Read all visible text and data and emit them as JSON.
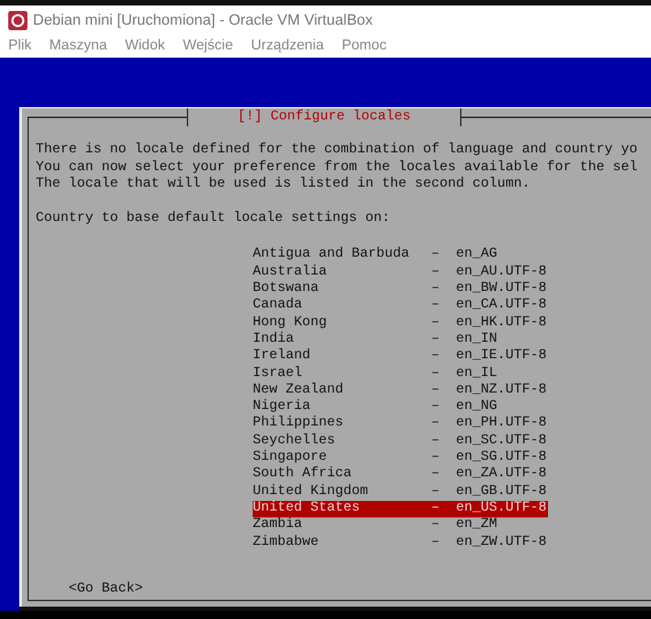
{
  "window": {
    "title": "Debian mini [Uruchomiona] - Oracle VM VirtualBox"
  },
  "menu": [
    "Plik",
    "Maszyna",
    "Widok",
    "Wejście",
    "Urządzenia",
    "Pomoc"
  ],
  "dialog": {
    "title": "[!] Configure locales",
    "message": [
      "There is no locale defined for the combination of language and country yo",
      "You can now select your preference from the locales available for the sel",
      "The locale that will be used is listed in the second column."
    ],
    "prompt": "Country to base default locale settings on:",
    "locales": [
      {
        "country": "Antigua and Barbuda",
        "separator": "–",
        "code": "en_AG",
        "selected": false
      },
      {
        "country": "Australia",
        "separator": "–",
        "code": "en_AU.UTF-8",
        "selected": false
      },
      {
        "country": "Botswana",
        "separator": "–",
        "code": "en_BW.UTF-8",
        "selected": false
      },
      {
        "country": "Canada",
        "separator": "–",
        "code": "en_CA.UTF-8",
        "selected": false
      },
      {
        "country": "Hong Kong",
        "separator": "–",
        "code": "en_HK.UTF-8",
        "selected": false
      },
      {
        "country": "India",
        "separator": "–",
        "code": "en_IN",
        "selected": false
      },
      {
        "country": "Ireland",
        "separator": "–",
        "code": "en_IE.UTF-8",
        "selected": false
      },
      {
        "country": "Israel",
        "separator": "–",
        "code": "en_IL",
        "selected": false
      },
      {
        "country": "New Zealand",
        "separator": "–",
        "code": "en_NZ.UTF-8",
        "selected": false
      },
      {
        "country": "Nigeria",
        "separator": "–",
        "code": "en_NG",
        "selected": false
      },
      {
        "country": "Philippines",
        "separator": "–",
        "code": "en_PH.UTF-8",
        "selected": false
      },
      {
        "country": "Seychelles",
        "separator": "–",
        "code": "en_SC.UTF-8",
        "selected": false
      },
      {
        "country": "Singapore",
        "separator": "–",
        "code": "en_SG.UTF-8",
        "selected": false
      },
      {
        "country": "South Africa",
        "separator": "–",
        "code": "en_ZA.UTF-8",
        "selected": false
      },
      {
        "country": "United Kingdom",
        "separator": "–",
        "code": "en_GB.UTF-8",
        "selected": false
      },
      {
        "country": "United States",
        "separator": "–",
        "code": "en_US.UTF-8",
        "selected": true
      },
      {
        "country": "Zambia",
        "separator": "–",
        "code": "en_ZM",
        "selected": false
      },
      {
        "country": "Zimbabwe",
        "separator": "–",
        "code": "en_ZW.UTF-8",
        "selected": false
      }
    ],
    "back_button": "<Go Back>"
  }
}
